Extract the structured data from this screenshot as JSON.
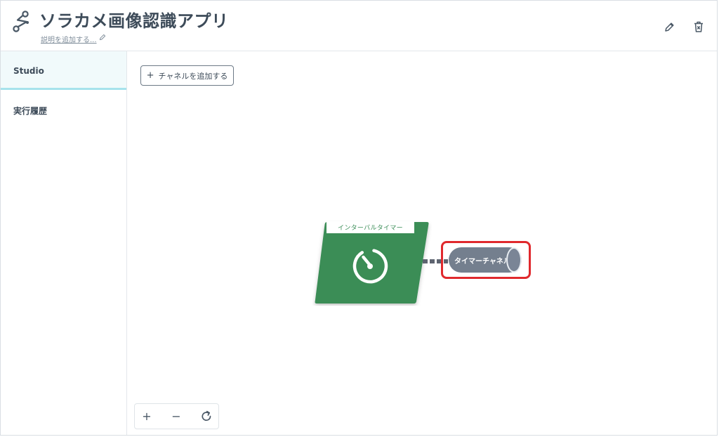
{
  "header": {
    "title": "ソラカメ画像認識アプリ",
    "description_link": "説明を追加する...",
    "icons": {
      "app": "flow-icon",
      "description": "pencil-icon",
      "edit": "pencil-icon",
      "delete": "trash-icon"
    }
  },
  "sidebar": {
    "items": [
      {
        "label": "Studio",
        "active": true
      },
      {
        "label": "実行履歴",
        "active": false
      }
    ]
  },
  "canvas": {
    "add_channel_button": {
      "icon": "+",
      "label": "チャネルを追加する"
    },
    "timer_node": {
      "label": "インターバルタイマー",
      "icon": "timer-icon",
      "color": "#3a8d57"
    },
    "channel_node": {
      "label": "タイマーチャネル",
      "color": "#747f8e",
      "highlight_color": "#e0292d"
    },
    "zoom_controls": {
      "zoom_in": "+",
      "zoom_out": "−",
      "reset_icon": "reset-icon"
    }
  }
}
